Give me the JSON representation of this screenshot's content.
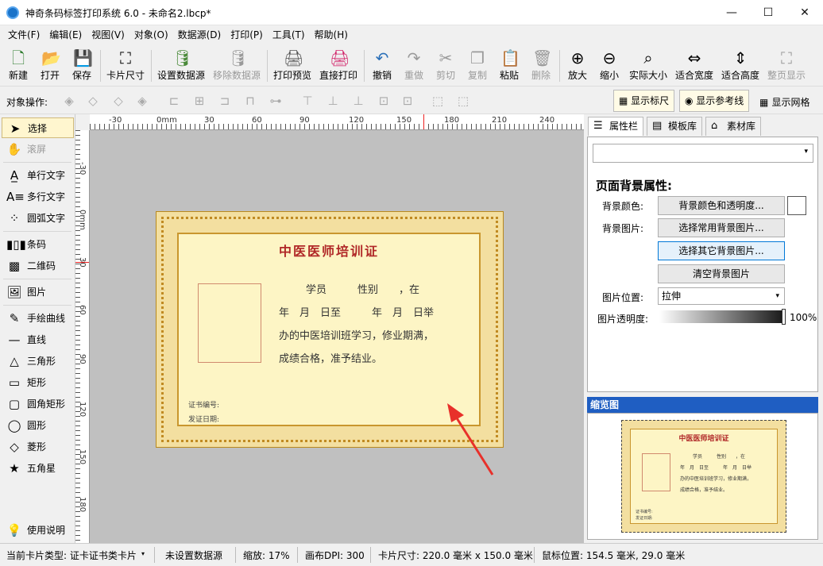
{
  "window": {
    "title": "神奇条码标签打印系统 6.0 - 未命名2.lbcp*"
  },
  "menu": [
    "文件(F)",
    "编辑(E)",
    "视图(V)",
    "对象(O)",
    "数据源(D)",
    "打印(P)",
    "工具(T)",
    "帮助(H)"
  ],
  "toolbar": {
    "new": "新建",
    "open": "打开",
    "save": "保存",
    "card_size": "卡片尺寸",
    "set_ds": "设置数据源",
    "remove_ds": "移除数据源",
    "print_preview": "打印预览",
    "direct_print": "直接打印",
    "undo": "撤销",
    "redo": "重做",
    "cut": "剪切",
    "copy": "复制",
    "paste": "粘贴",
    "delete": "删除",
    "zoom_in": "放大",
    "zoom_out": "缩小",
    "actual_size": "实际大小",
    "fit_width": "适合宽度",
    "fit_height": "适合高度",
    "full_page": "整页显示"
  },
  "objbar": {
    "label": "对象操作:",
    "show_ruler": "显示标尺",
    "show_guides": "显示参考线",
    "show_grid": "显示网格"
  },
  "tools": [
    "选择",
    "滚屏",
    "单行文字",
    "多行文字",
    "圆弧文字",
    "条码",
    "二维码",
    "图片",
    "手绘曲线",
    "直线",
    "三角形",
    "矩形",
    "圆角矩形",
    "圆形",
    "菱形",
    "五角星",
    "使用说明"
  ],
  "ruler": {
    "h": [
      "-30",
      "0mm",
      "30",
      "60",
      "90",
      "120",
      "150",
      "180",
      "210",
      "240"
    ],
    "v": [
      "-30",
      "0mm",
      "30",
      "60",
      "90",
      "120",
      "150",
      "180"
    ]
  },
  "certificate": {
    "title": "中医医师培训证",
    "line1": "学员　　　性别　　，在",
    "line2": "年　月　日至　　　年　月　日举",
    "line3": "办的中医培训班学习，修业期满，",
    "line4": "成绩合格，准予结业。",
    "cert_no": "证书编号:",
    "issue_date": "发证日期:"
  },
  "panel": {
    "tabs": [
      "属性栏",
      "模板库",
      "素材库"
    ],
    "section_title": "页面背景属性:",
    "bg_color_label": "背景颜色:",
    "bg_color_btn": "背景颜色和透明度...",
    "bg_image_label": "背景图片:",
    "bg_common_btn": "选择常用背景图片...",
    "bg_other_btn": "选择其它背景图片...",
    "bg_clear_btn": "清空背景图片",
    "img_pos_label": "图片位置:",
    "img_pos_value": "拉伸",
    "img_opacity_label": "图片透明度:",
    "img_opacity_value": "100%",
    "preview_title": "缩览图"
  },
  "status": {
    "card_type": "当前卡片类型: 证卡证书类卡片",
    "ds": "未设置数据源",
    "zoom": "缩放: 17%",
    "dpi": "画布DPI: 300",
    "card_size": "卡片尺寸: 220.0 毫米 x 150.0 毫米",
    "mouse": "鼠标位置: 154.5 毫米, 29.0 毫米"
  },
  "colors": {
    "accent": "#1f5ec2",
    "cert_red": "#b02727",
    "cert_gold": "#c9962e",
    "arrow": "#e8302a"
  }
}
